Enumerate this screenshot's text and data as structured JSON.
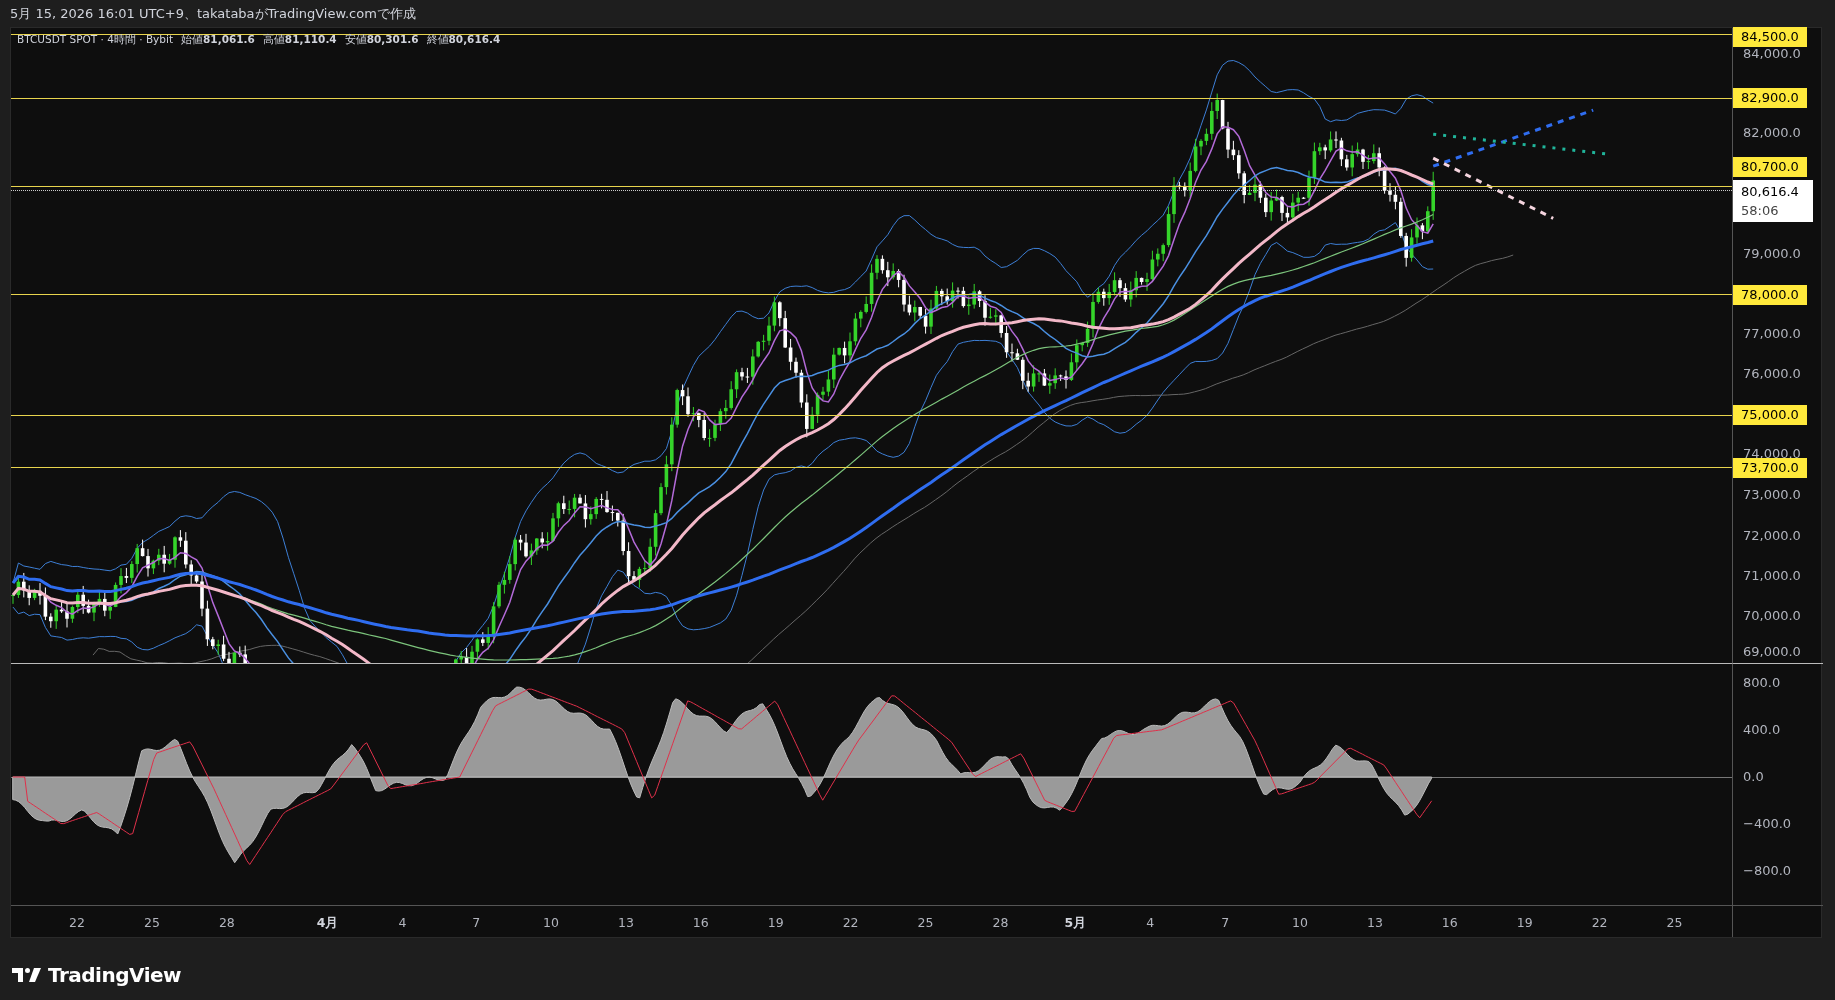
{
  "header": {
    "text": "5月 15, 2026 16:01 UTC+9、takatabaがTradingView.comで作成"
  },
  "legend": {
    "symbol": "BTCUSDT SPOT · 4時間 · Bybit",
    "values": [
      {
        "label": "始値",
        "value": "81,061.6"
      },
      {
        "label": "高値",
        "value": "81,110.4"
      },
      {
        "label": "安値",
        "value": "80,301.6"
      },
      {
        "label": "終値",
        "value": "80,616.4"
      }
    ]
  },
  "price_axis": [
    {
      "kind": "level",
      "text": "84,500.0"
    },
    {
      "kind": "tick",
      "text": "84,000.0"
    },
    {
      "kind": "level",
      "text": "82,900.0"
    },
    {
      "kind": "tick",
      "text": "82,000.0"
    },
    {
      "kind": "level",
      "text": "80,700.0"
    },
    {
      "kind": "price",
      "text": "80,616.4",
      "countdown": "58:06"
    },
    {
      "kind": "tick",
      "text": "79,000.0"
    },
    {
      "kind": "level",
      "text": "78,000.0"
    },
    {
      "kind": "tick",
      "text": "77,000.0"
    },
    {
      "kind": "tick",
      "text": "76,000.0"
    },
    {
      "kind": "level",
      "text": "75,000.0"
    },
    {
      "kind": "tick",
      "text": "74,000.0"
    },
    {
      "kind": "level",
      "text": "73,700.0"
    },
    {
      "kind": "tick",
      "text": "73,000.0"
    },
    {
      "kind": "tick",
      "text": "72,000.0"
    },
    {
      "kind": "tick",
      "text": "71,000.0"
    },
    {
      "kind": "tick",
      "text": "70,000.0"
    },
    {
      "kind": "tick",
      "text": "69,000.0"
    }
  ],
  "oscillator_axis": [
    "800.0",
    "400.0",
    "0.0",
    "−400.0",
    "−800.0"
  ],
  "time_axis": [
    {
      "kind": "day",
      "text": "22"
    },
    {
      "kind": "day",
      "text": "25"
    },
    {
      "kind": "day",
      "text": "28"
    },
    {
      "kind": "month",
      "text": "4月"
    },
    {
      "kind": "day",
      "text": "4"
    },
    {
      "kind": "day",
      "text": "7"
    },
    {
      "kind": "day",
      "text": "10"
    },
    {
      "kind": "day",
      "text": "13"
    },
    {
      "kind": "day",
      "text": "16"
    },
    {
      "kind": "day",
      "text": "19"
    },
    {
      "kind": "day",
      "text": "22"
    },
    {
      "kind": "day",
      "text": "25"
    },
    {
      "kind": "day",
      "text": "28"
    },
    {
      "kind": "month",
      "text": "5月"
    },
    {
      "kind": "day",
      "text": "4"
    },
    {
      "kind": "day",
      "text": "7"
    },
    {
      "kind": "day",
      "text": "10"
    },
    {
      "kind": "day",
      "text": "13"
    },
    {
      "kind": "day",
      "text": "16"
    },
    {
      "kind": "day",
      "text": "19"
    },
    {
      "kind": "day",
      "text": "22"
    },
    {
      "kind": "day",
      "text": "25"
    }
  ],
  "footer": {
    "brand": "TradingView"
  }
}
